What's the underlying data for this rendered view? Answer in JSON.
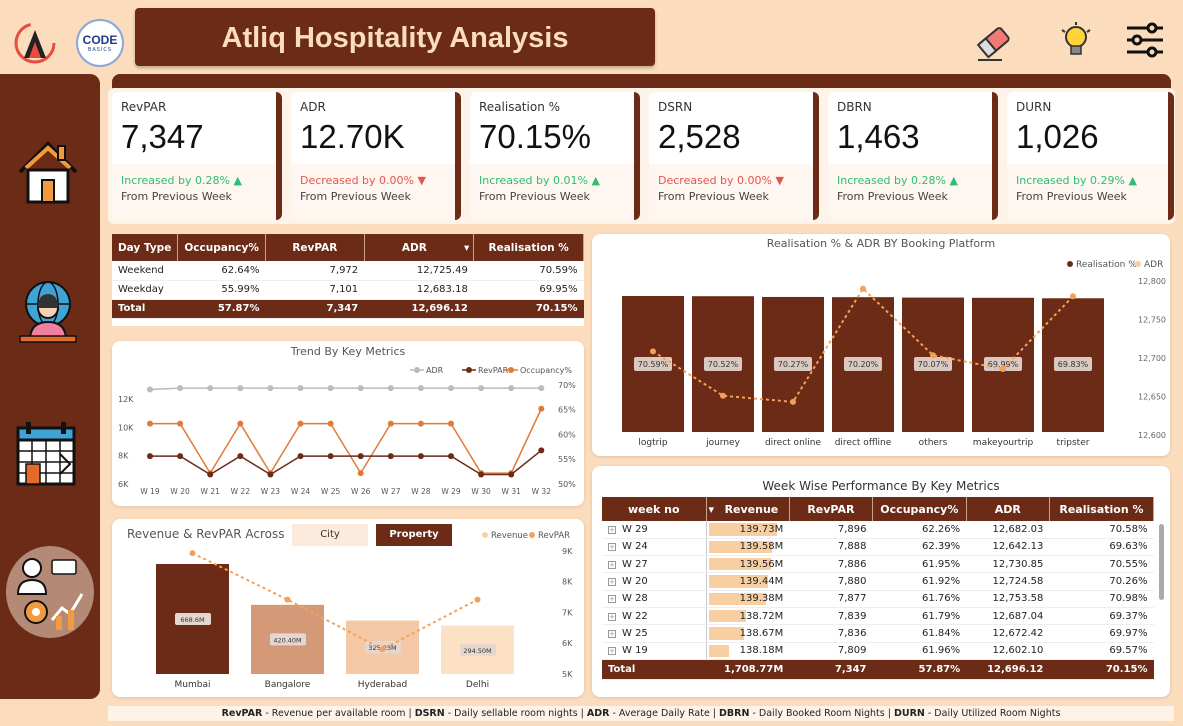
{
  "header": {
    "title": "Atliq Hospitality Analysis",
    "codebasics_logo_text": "CODE",
    "codebasics_logo_sub": "BASICS",
    "icons": [
      "eraser-icon",
      "lightbulb-icon",
      "sliders-icon"
    ]
  },
  "colors": {
    "brand": "#6b2b16",
    "background": "#fbdcbc",
    "accent": "#f4a05a",
    "up": "#2ebd73",
    "down": "#e8544d"
  },
  "nav": [
    "home-icon",
    "customer-service-icon",
    "calendar-icon",
    "analyst-icon"
  ],
  "kpis": [
    {
      "label": "RevPAR",
      "value": "7,347",
      "change": "Increased by 0.28%",
      "dir": "up",
      "from": "From Previous Week"
    },
    {
      "label": "ADR",
      "value": "12.70K",
      "change": "Decreased by 0.00%",
      "dir": "down",
      "from": "From Previous Week"
    },
    {
      "label": "Realisation %",
      "value": "70.15%",
      "change": "Increased by 0.01%",
      "dir": "up",
      "from": "From Previous Week"
    },
    {
      "label": "DSRN",
      "value": "2,528",
      "change": "Decreased by 0.00%",
      "dir": "down",
      "from": "From Previous Week"
    },
    {
      "label": "DBRN",
      "value": "1,463",
      "change": "Increased by 0.28%",
      "dir": "up",
      "from": "From Previous Week"
    },
    {
      "label": "DURN",
      "value": "1,026",
      "change": "Increased by 0.29%",
      "dir": "up",
      "from": "From Previous Week"
    }
  ],
  "daytype": {
    "headers": [
      "Day Type",
      "Occupancy%",
      "RevPAR",
      "ADR",
      "Realisation %"
    ],
    "rows": [
      [
        "Weekend",
        "62.64%",
        "7,972",
        "12,725.49",
        "70.59%"
      ],
      [
        "Weekday",
        "55.99%",
        "7,101",
        "12,683.18",
        "69.95%"
      ]
    ],
    "total": [
      "Total",
      "57.87%",
      "7,347",
      "12,696.12",
      "70.15%"
    ]
  },
  "platform_chart": {
    "title": "Realisation % & ADR BY Booking Platform",
    "legend": [
      "Realisation %",
      "ADR"
    ],
    "categories": [
      "logtrip",
      "journey",
      "direct online",
      "direct offline",
      "others",
      "makeyourtrip",
      "tripster"
    ],
    "realisation": [
      70.59,
      70.52,
      70.27,
      70.2,
      70.07,
      69.99,
      69.83
    ],
    "realisation_labels": [
      "70.59%",
      "70.52%",
      "70.27%",
      "70.20%",
      "70.07%",
      "69.99%",
      "69.83%"
    ],
    "adr": [
      12708,
      12650,
      12642,
      12790,
      12703,
      12685,
      12780
    ],
    "adr_ticks": [
      "12,800",
      "12,750",
      "12,700",
      "12,650",
      "12,600"
    ]
  },
  "trend_chart": {
    "title": "Trend By Key Metrics",
    "legend": [
      "ADR",
      "RevPAR",
      "Occupancy%"
    ],
    "weeks": [
      "W 19",
      "W 20",
      "W 21",
      "W 22",
      "W 23",
      "W 24",
      "W 25",
      "W 26",
      "W 27",
      "W 28",
      "W 29",
      "W 30",
      "W 31",
      "W 32"
    ],
    "adr": [
      12.6,
      12.7,
      12.7,
      12.7,
      12.7,
      12.7,
      12.7,
      12.7,
      12.7,
      12.7,
      12.7,
      12.7,
      12.7,
      12.7
    ],
    "revpar": [
      7.9,
      7.9,
      6.6,
      7.9,
      6.6,
      7.9,
      7.9,
      7.9,
      7.9,
      7.9,
      7.9,
      6.6,
      6.6,
      8.3
    ],
    "occupancy": [
      62,
      62,
      52,
      62,
      52,
      62,
      62,
      52,
      62,
      62,
      62,
      52,
      52,
      65
    ],
    "y_left": [
      "12K",
      "10K",
      "8K",
      "6K"
    ],
    "y_right": [
      "70%",
      "65%",
      "60%",
      "55%",
      "50%"
    ]
  },
  "revenue_chart": {
    "title": "Revenue & RevPAR Across",
    "toggle": [
      "City",
      "Property"
    ],
    "legend": [
      "Revenue",
      "RevPAR"
    ],
    "categories": [
      "Mumbai",
      "Bangalore",
      "Hyderabad",
      "Delhi"
    ],
    "revenue": [
      668.6,
      420.4,
      325.2,
      294.5
    ],
    "revenue_labels": [
      "668.6M",
      "420.40M",
      "325.23M",
      "294.50M"
    ],
    "revpar": [
      8.9,
      7.4,
      5.8,
      7.4
    ],
    "y_right": [
      "9K",
      "8K",
      "7K",
      "6K",
      "5K"
    ]
  },
  "weekly": {
    "title": "Week Wise Performance By Key Metrics",
    "headers": [
      "week no",
      "Revenue",
      "RevPAR",
      "Occupancy%",
      "ADR",
      "Realisation %"
    ],
    "rows": [
      [
        "W 29",
        "139.73M",
        "7,896",
        "62.26%",
        "12,682.03",
        "70.58%"
      ],
      [
        "W 24",
        "139.58M",
        "7,888",
        "62.39%",
        "12,642.13",
        "69.63%"
      ],
      [
        "W 27",
        "139.56M",
        "7,886",
        "61.95%",
        "12,730.85",
        "70.55%"
      ],
      [
        "W 20",
        "139.44M",
        "7,880",
        "61.92%",
        "12,724.58",
        "70.26%"
      ],
      [
        "W 28",
        "139.38M",
        "7,877",
        "61.76%",
        "12,753.58",
        "70.98%"
      ],
      [
        "W 22",
        "138.72M",
        "7,839",
        "61.79%",
        "12,687.04",
        "69.37%"
      ],
      [
        "W 25",
        "138.67M",
        "7,836",
        "61.84%",
        "12,672.42",
        "69.97%"
      ],
      [
        "W 19",
        "138.18M",
        "7,809",
        "61.96%",
        "12,602.10",
        "69.57%"
      ]
    ],
    "revenue_values": [
      139.73,
      139.58,
      139.56,
      139.44,
      139.38,
      138.72,
      138.67,
      138.18
    ],
    "total": [
      "Total",
      "1,708.77M",
      "7,347",
      "57.87%",
      "12,696.12",
      "70.15%"
    ]
  },
  "footer": [
    {
      "term": "RevPAR",
      "desc": " - Revenue per available room | "
    },
    {
      "term": "DSRN",
      "desc": " - Daily sellable room nights | "
    },
    {
      "term": "ADR",
      "desc": " - Average Daily Rate | "
    },
    {
      "term": "DBRN",
      "desc": " - Daily Booked Room Nights | "
    },
    {
      "term": "DURN",
      "desc": " - Daily Utilized Room Nights"
    }
  ]
}
